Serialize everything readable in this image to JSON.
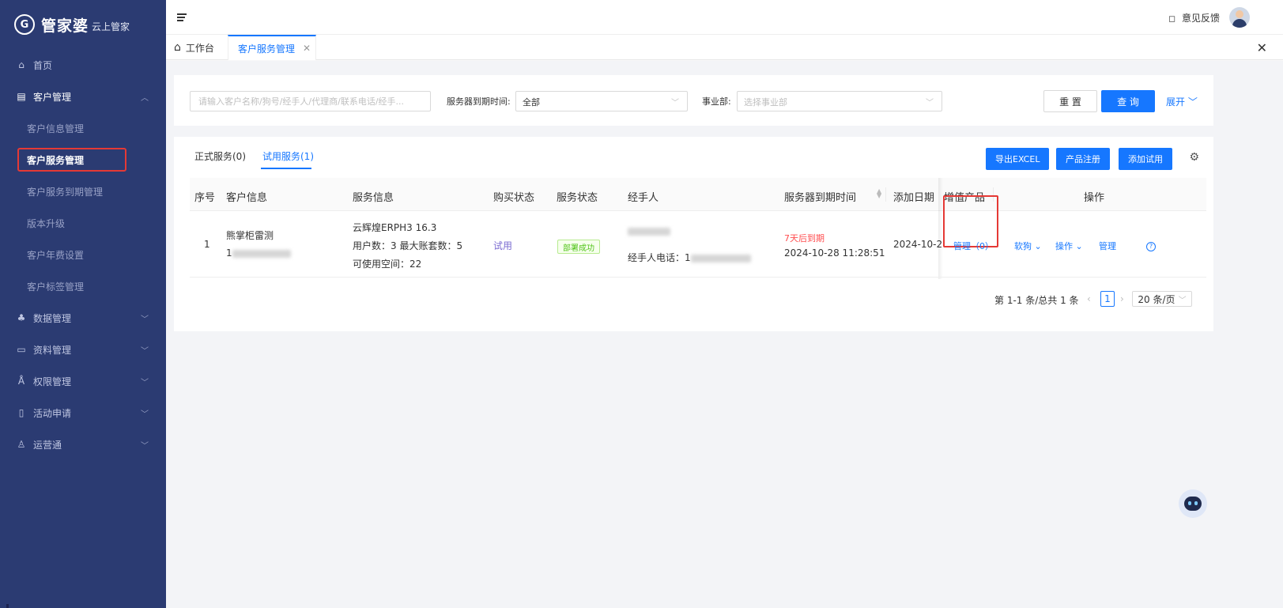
{
  "logo": {
    "main": "管家婆",
    "sub": "云上管家"
  },
  "sidebar": {
    "items": [
      {
        "icon": "home-icon",
        "label": "首页"
      },
      {
        "icon": "customer-icon",
        "label": "客户管理"
      },
      {
        "icon": "data-icon",
        "label": "数据管理"
      },
      {
        "icon": "folder-icon",
        "label": "资料管理"
      },
      {
        "icon": "user-icon",
        "label": "权限管理"
      },
      {
        "icon": "document-icon",
        "label": "活动申请"
      },
      {
        "icon": "network-icon",
        "label": "运营通"
      }
    ],
    "subitems": [
      "客户信息管理",
      "客户服务管理",
      "客户服务到期管理",
      "版本升级",
      "客户年费设置",
      "客户标签管理"
    ]
  },
  "topbar": {
    "feedback": "意见反馈"
  },
  "tabs": {
    "home": "工作台",
    "active": "客户服务管理"
  },
  "filter": {
    "search_placeholder": "请输入客户名称/狗号/经手人/代理商/联系电话/经手...",
    "expire_label": "服务器到期时间:",
    "expire_value": "全部",
    "dept_label": "事业部:",
    "dept_placeholder": "选择事业部",
    "reset": "重 置",
    "query": "查 询",
    "expand": "展开"
  },
  "service_tabs": {
    "formal": "正式服务(0)",
    "trial": "试用服务(1)"
  },
  "toolbar": {
    "export": "导出EXCEL",
    "register": "产品注册",
    "add_trial": "添加试用"
  },
  "table": {
    "headers": [
      "序号",
      "客户信息",
      "服务信息",
      "购买状态",
      "服务状态",
      "经手人",
      "服务器到期时间",
      "添加日期",
      "增值产品",
      "操作"
    ],
    "row": {
      "index": "1",
      "customer_name": "熊掌柜雷测",
      "customer_phone_prefix": "1",
      "service_product": "云辉煌ERPH3 16.3",
      "service_users": "用户数：3 最大账套数：5",
      "service_space": "可使用空间：22",
      "purchase_status": "试用",
      "service_status": "部署成功",
      "handler_phone_label": "经手人电话：1",
      "expire_warning": "7天后到期",
      "expire_time": "2024-10-28 11:28:51",
      "add_date": "2024-10-2",
      "value_added": "管理（0）",
      "op_softdog": "软狗",
      "op_operate": "操作",
      "op_manage": "管理",
      "op_help": "?"
    }
  },
  "pagination": {
    "summary": "第 1-1 条/总共 1 条",
    "current": "1",
    "page_size": "20 条/页"
  },
  "colors": {
    "sidebar_bg": "#2b3b72",
    "primary": "#1677ff",
    "highlight": "#e53935"
  }
}
